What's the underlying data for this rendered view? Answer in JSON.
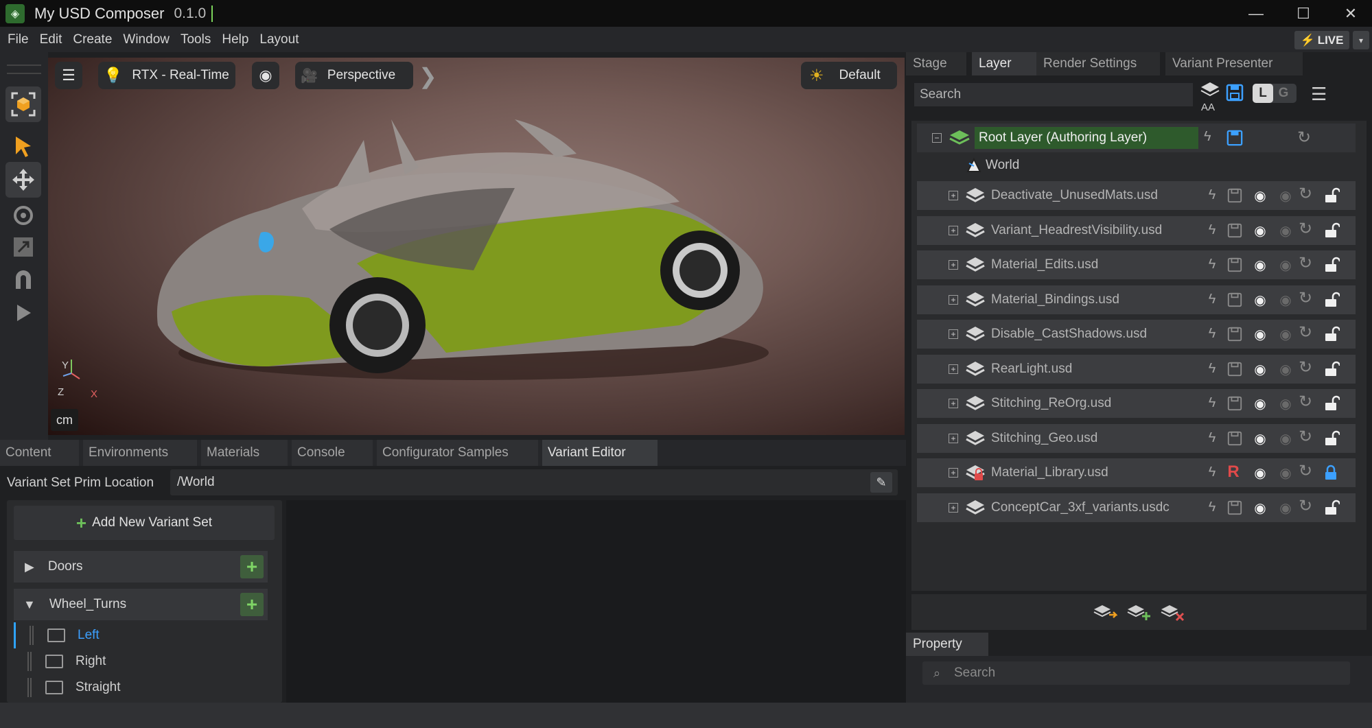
{
  "window": {
    "title": "My USD Composer",
    "version": "0.1.0",
    "minimize": "—",
    "maximize": "☐",
    "close": "✕"
  },
  "menu": [
    "File",
    "Edit",
    "Create",
    "Window",
    "Tools",
    "Help",
    "Layout"
  ],
  "live": {
    "label": "LIVE",
    "bolt": "⚡",
    "dropdown": "▾"
  },
  "viewport": {
    "renderer": "RTX - Real-Time",
    "camera": "Perspective",
    "lighting": "Default",
    "units": "cm",
    "axes": {
      "y": "Y",
      "z": "Z",
      "x": "X"
    },
    "colors": {
      "car_body": "#7f9a1e",
      "background": "#735a55"
    }
  },
  "bottom_tabs": [
    "Content",
    "Environments",
    "Materials",
    "Console",
    "Configurator Samples",
    "Variant Editor"
  ],
  "variant_editor": {
    "prim_location_label": "Variant Set Prim Location",
    "prim_location_value": "/World",
    "add_variant_set": "Add New Variant Set",
    "variant_sets": [
      {
        "name": "Doors",
        "expanded": false
      },
      {
        "name": "Wheel_Turns",
        "expanded": true,
        "variants": [
          "Left",
          "Right",
          "Straight"
        ],
        "selected": "Left"
      }
    ]
  },
  "stage_tabs": [
    "Stage",
    "Layer",
    "Render Settings",
    "Variant Presenter"
  ],
  "layer": {
    "search_placeholder": "Search",
    "aa_label": "AA",
    "l_label": "L",
    "g_label": "G",
    "root": "Root Layer (Authoring Layer)",
    "world": "World",
    "sublayers": [
      "Deactivate_UnusedMats.usd",
      "Variant_HeadrestVisibility.usd",
      "Material_Edits.usd",
      "Material_Bindings.usd",
      "Disable_CastShadows.usd",
      "RearLight.usd",
      "Stitching_ReOrg.usd",
      "Stitching_Geo.usd",
      "Material_Library.usd",
      "ConceptCar_3xf_variants.usdc"
    ],
    "readonly_marker": "R",
    "accent": "#3ca0ff"
  },
  "property": {
    "tab": "Property",
    "search_placeholder": "Search"
  }
}
